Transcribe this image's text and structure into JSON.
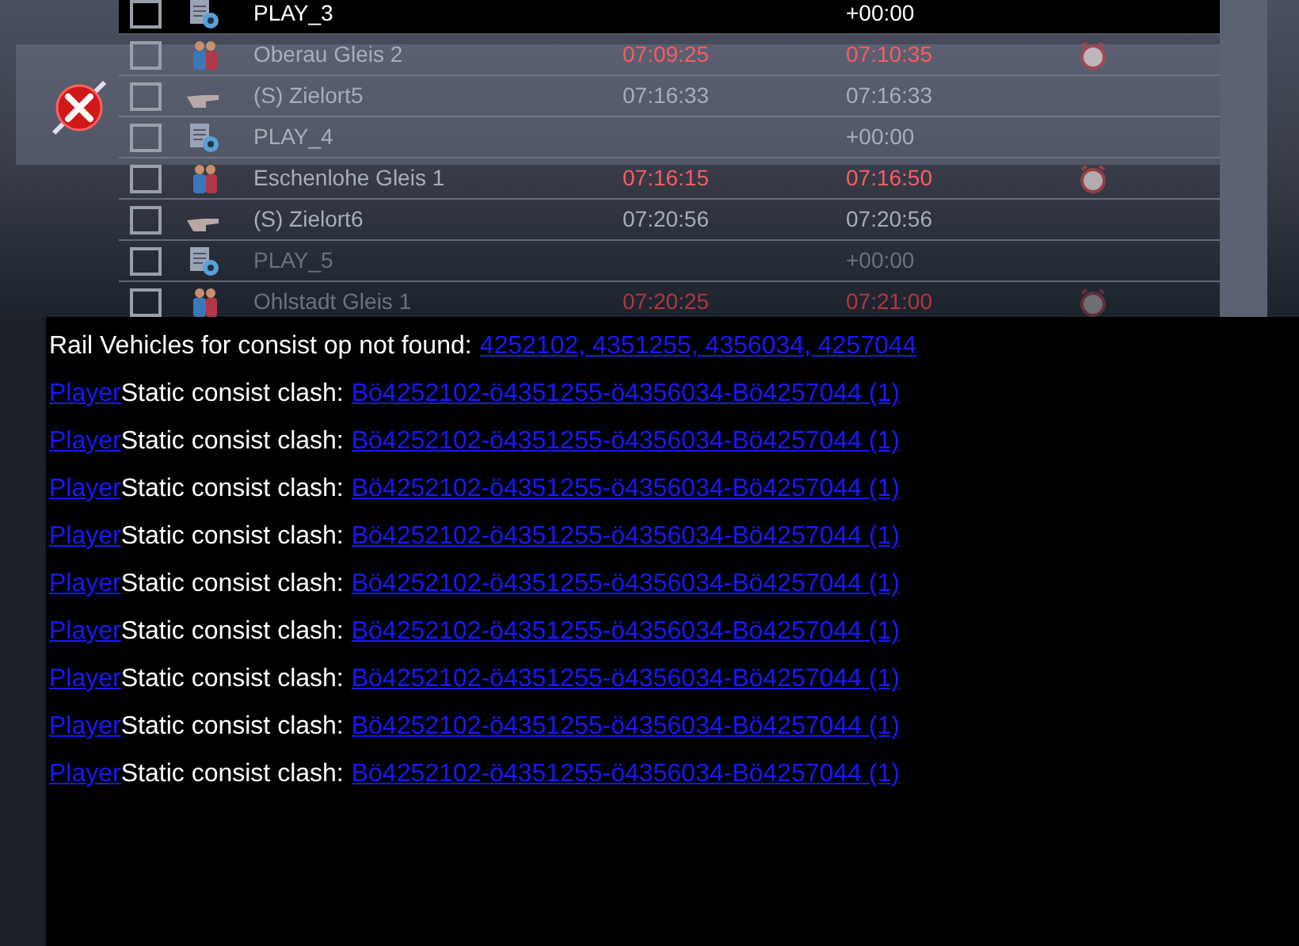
{
  "stops": [
    {
      "kind": "play",
      "label": "PLAY_3",
      "checked": false,
      "alarm": false,
      "departure": "+00:00"
    },
    {
      "kind": "passenger",
      "label": "Oberau Gleis 2",
      "checked": false,
      "alarm": true,
      "arrival": "07:09:25",
      "departure": "07:10:35"
    },
    {
      "kind": "target",
      "label": "(S) Zielort5",
      "checked": false,
      "alarm": false,
      "arrival": "07:16:33",
      "departure": "07:16:33"
    },
    {
      "kind": "play",
      "label": "PLAY_4",
      "checked": false,
      "alarm": false,
      "departure": "+00:00"
    },
    {
      "kind": "passenger",
      "label": "Eschenlohe Gleis 1",
      "checked": false,
      "alarm": true,
      "arrival": "07:16:15",
      "departure": "07:16:50"
    },
    {
      "kind": "target",
      "label": "(S) Zielort6",
      "checked": false,
      "alarm": false,
      "arrival": "07:20:56",
      "departure": "07:20:56"
    },
    {
      "kind": "play",
      "label": "PLAY_5",
      "checked": false,
      "alarm": false,
      "departure": "+00:00"
    },
    {
      "kind": "passenger",
      "label": "Ohlstadt Gleis 1",
      "checked": false,
      "alarm": true,
      "arrival": "07:20:25",
      "departure": "07:21:00"
    }
  ],
  "log": [
    {
      "text": "Rail Vehicles for consist op not found:",
      "link": "4252102, 4351255, 4356034, 4257044"
    },
    {
      "prefix": "Player",
      "text": "Static consist clash:",
      "link": "Bö4252102-ö4351255-ö4356034-Bö4257044 (1)"
    },
    {
      "prefix": "Player",
      "text": "Static consist clash:",
      "link": "Bö4252102-ö4351255-ö4356034-Bö4257044 (1)"
    },
    {
      "prefix": "Player",
      "text": "Static consist clash:",
      "link": "Bö4252102-ö4351255-ö4356034-Bö4257044 (1)"
    },
    {
      "prefix": "Player",
      "text": "Static consist clash:",
      "link": "Bö4252102-ö4351255-ö4356034-Bö4257044 (1)"
    },
    {
      "prefix": "Player",
      "text": "Static consist clash:",
      "link": "Bö4252102-ö4351255-ö4356034-Bö4257044 (1)"
    },
    {
      "prefix": "Player",
      "text": "Static consist clash:",
      "link": "Bö4252102-ö4351255-ö4356034-Bö4257044 (1)"
    },
    {
      "prefix": "Player",
      "text": "Static consist clash:",
      "link": "Bö4252102-ö4351255-ö4356034-Bö4257044 (1)"
    },
    {
      "prefix": "Player",
      "text": "Static consist clash:",
      "link": "Bö4252102-ö4351255-ö4356034-Bö4257044 (1)"
    },
    {
      "prefix": "Player",
      "text": "Static consist clash:",
      "link": "Bö4252102-ö4351255-ö4356034-Bö4257044 (1)"
    }
  ]
}
